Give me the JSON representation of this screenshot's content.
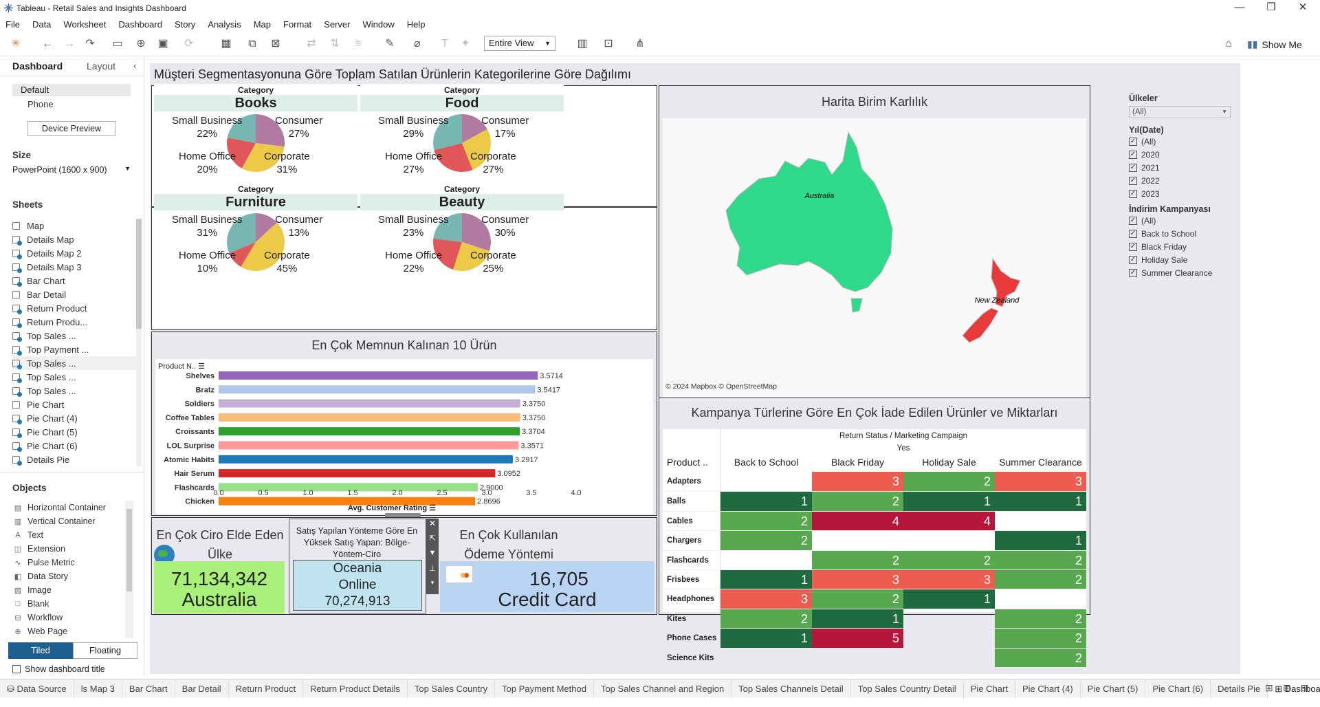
{
  "window": {
    "title": "Tableau - Retail Sales and Insights Dashboard"
  },
  "menu": [
    "File",
    "Data",
    "Worksheet",
    "Dashboard",
    "Story",
    "Analysis",
    "Map",
    "Format",
    "Server",
    "Window",
    "Help"
  ],
  "toolbar": {
    "fit": "Entire View",
    "show_me": "Show Me"
  },
  "left": {
    "tabs": {
      "dashboard": "Dashboard",
      "layout": "Layout"
    },
    "devices": [
      "Default",
      "Phone"
    ],
    "device_preview": "Device Preview",
    "size_label": "Size",
    "size_value": "PowerPoint (1600 x 900)",
    "sheets_label": "Sheets",
    "sheets": [
      "Map",
      "Details Map",
      "Details Map 2",
      "Details Map 3",
      "Bar Chart",
      "Bar Detail",
      "Return Product",
      "Return Produ...",
      "Top Sales ...",
      "Top Payment ...",
      "Top Sales ...",
      "Top Sales ...",
      "Top Sales ...",
      "Pie Chart",
      "Pie Chart (4)",
      "Pie Chart (5)",
      "Pie Chart (6)",
      "Details Pie"
    ],
    "objects_label": "Objects",
    "objects": [
      "Horizontal Container",
      "Vertical Container",
      "Text",
      "Extension",
      "Pulse Metric",
      "Data Story",
      "Image",
      "Blank",
      "Workflow",
      "Web Page"
    ],
    "tiled": "Tiled",
    "floating": "Floating",
    "show_title": "Show dashboard title"
  },
  "dashboard": {
    "title": "Müşteri Segmentasyonuna Göre Toplam Satılan Ürünlerin Kategorilerine Göre Dağılımı",
    "category_label": "Category",
    "pies": [
      {
        "name": "Books",
        "small_business": "22%",
        "consumer": "27%",
        "home_office": "20%",
        "corporate": "31%"
      },
      {
        "name": "Food",
        "small_business": "29%",
        "consumer": "17%",
        "home_office": "27%",
        "corporate": "27%"
      },
      {
        "name": "Furniture",
        "small_business": "31%",
        "consumer": "13%",
        "home_office": "10%",
        "corporate": "45%"
      },
      {
        "name": "Beauty",
        "small_business": "23%",
        "consumer": "30%",
        "home_office": "22%",
        "corporate": "25%"
      }
    ],
    "seg_labels": {
      "sb": "Small Business",
      "co": "Consumer",
      "ho": "Home Office",
      "cp": "Corporate"
    },
    "seg_colors": {
      "co": "#b07aa1",
      "cp": "#edc948",
      "ho": "#e15759",
      "sb": "#76b7b2"
    },
    "map": {
      "title": "Harita Birim Karlılık",
      "australia": "Australia",
      "nz": "New Zealand",
      "credit": "© 2024 Mapbox © OpenStreetMap",
      "colors": {
        "au": "#2fd98a",
        "nz": "#e83a3a"
      }
    },
    "bar": {
      "title": "En Çok Memnun Kalınan 10 Ürün",
      "y_header": "Product N..",
      "x_label": "Avg. Customer Rating"
    },
    "kpi1": {
      "title": "En Çok Ciro Elde Eden Ülke",
      "value": "71,134,342",
      "country": "Australia"
    },
    "kpi2": {
      "title": "Satış Yapılan Yönteme Göre En Yüksek Satış Yapan: Bölge-Yöntem-Ciro",
      "region": "Oceania",
      "method": "Online",
      "value": "70,274,913"
    },
    "kpi3": {
      "title": "En Çok Kullanılan Ödeme Yöntemi",
      "value": "16,705",
      "method": "Credit Card"
    },
    "heatmap": {
      "title": "Kampanya Türlerine Göre En Çok İade Edilen Ürünler ve Miktarları",
      "header1": "Return Status / Marketing Campaign",
      "header2": "Yes",
      "row_header": "Product ..",
      "cols": [
        "Back to School",
        "Black Friday",
        "Holiday Sale",
        "Summer Clearance"
      ],
      "rows": [
        {
          "name": "Adapters",
          "vals": [
            "",
            "3",
            "2",
            "3"
          ]
        },
        {
          "name": "Balls",
          "vals": [
            "1",
            "2",
            "1",
            "1"
          ]
        },
        {
          "name": "Cables",
          "vals": [
            "2",
            "4",
            "4",
            ""
          ]
        },
        {
          "name": "Chargers",
          "vals": [
            "2",
            "",
            "",
            "1"
          ]
        },
        {
          "name": "Flashcards",
          "vals": [
            "",
            "2",
            "2",
            "2"
          ]
        },
        {
          "name": "Frisbees",
          "vals": [
            "1",
            "3",
            "3",
            "2"
          ]
        },
        {
          "name": "Headphones",
          "vals": [
            "3",
            "2",
            "1",
            ""
          ]
        },
        {
          "name": "Kites",
          "vals": [
            "2",
            "1",
            "",
            "2"
          ]
        },
        {
          "name": "Phone Cases",
          "vals": [
            "1",
            "5",
            "",
            "2"
          ]
        },
        {
          "name": "Science Kits",
          "vals": [
            "",
            "",
            "",
            "2"
          ]
        }
      ],
      "colors": {
        "1": "#1f6b3f",
        "2": "#57a84f",
        "3": "#ee5c4f",
        "4": "#b5163a",
        "5": "#b5163a"
      }
    },
    "filters": {
      "countries_label": "Ülkeler",
      "countries_value": "(All)",
      "year_label": "Yıl(Date)",
      "years": [
        "(All)",
        "2020",
        "2021",
        "2022",
        "2023"
      ],
      "campaign_label": "İndirim Kampanyası",
      "campaigns": [
        "(All)",
        "Back to School",
        "Black Friday",
        "Holiday Sale",
        "Summer Clearance"
      ]
    }
  },
  "chart_data": {
    "type": "bar",
    "title": "En Çok Memnun Kalınan 10 Ürün",
    "xlabel": "Avg. Customer Rating",
    "ylabel": "Product N..",
    "categories": [
      "Shelves",
      "Bratz",
      "Soldiers",
      "Coffee Tables",
      "Croissants",
      "LOL Surprise",
      "Atomic Habits",
      "Hair Serum",
      "Flashcards",
      "Chicken"
    ],
    "values": [
      3.5714,
      3.5417,
      3.375,
      3.375,
      3.3704,
      3.3571,
      3.2917,
      3.0952,
      2.9,
      2.8696
    ],
    "labels": [
      "3.5714",
      "3.5417",
      "3.3750",
      "3.3750",
      "3.3704",
      "3.3571",
      "3.2917",
      "3.0952",
      "2.9000",
      "2.8696"
    ],
    "colors": [
      "#9467bd",
      "#aec7e8",
      "#c5b0d5",
      "#ffbb78",
      "#2ca02c",
      "#ff9896",
      "#1f77b4",
      "#d62728",
      "#98df8a",
      "#ff7f0e"
    ],
    "xlim": [
      0,
      4
    ],
    "xticks": [
      "0.0",
      "0.5",
      "1.0",
      "1.5",
      "2.0",
      "2.5",
      "3.0",
      "3.5",
      "4.0"
    ]
  },
  "status_tabs": [
    "Data Source",
    "ls Map 3",
    "Bar Chart",
    "Bar Detail",
    "Return Product",
    "Return Product Details",
    "Top Sales Country",
    "Top Payment Method",
    "Top Sales Channel and Region",
    "Top Sales Channels Detail",
    "Top Sales Country Detail",
    "Pie Chart",
    "Pie Chart (4)",
    "Pie Chart (5)",
    "Pie Chart (6)",
    "Details Pie",
    "Dashboard"
  ]
}
